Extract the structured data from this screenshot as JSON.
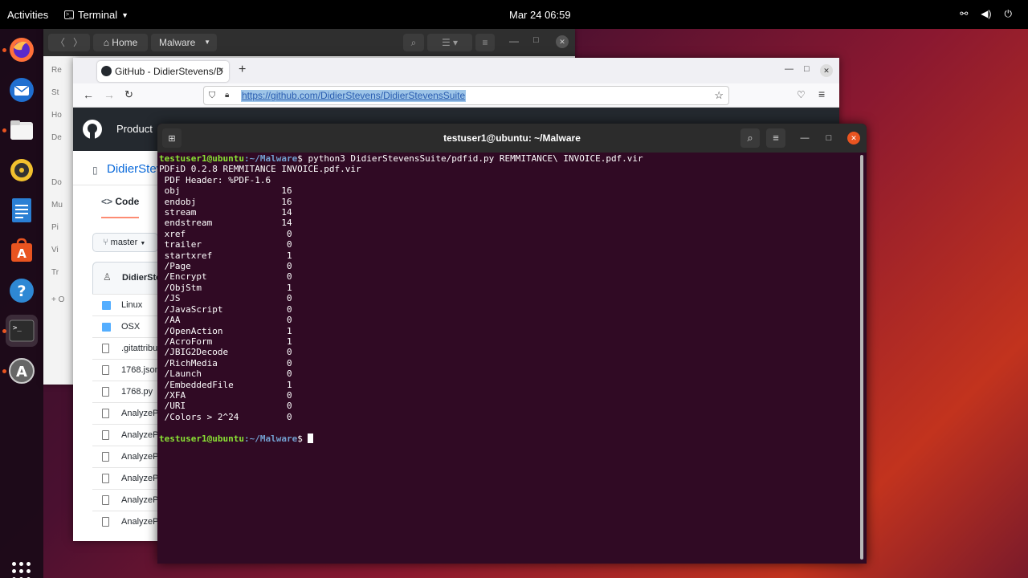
{
  "topbar": {
    "activities": "Activities",
    "app": "Terminal",
    "clock": "Mar 24  06:59"
  },
  "files_window": {
    "home": "Home",
    "location": "Malware",
    "sidebar": [
      "Re",
      "St",
      "Ho",
      "De",
      "Do",
      "Mu",
      "Pi",
      "Vi",
      "Tr",
      "+ O"
    ]
  },
  "browser": {
    "tab_title": "GitHub - DidierStevens/D",
    "url": "https://github.com/DidierStevens/DidierStevensSuite",
    "nav_product": "Product",
    "repo_owner": "DidierStev",
    "code_tab": "Code",
    "branch": "master",
    "commit_author": "DidierSte",
    "files": [
      {
        "name": "Linux",
        "type": "folder"
      },
      {
        "name": "OSX",
        "type": "folder"
      },
      {
        "name": ".gitattribut",
        "type": "file"
      },
      {
        "name": "1768.json",
        "type": "file"
      },
      {
        "name": "1768.py",
        "type": "file"
      },
      {
        "name": "AnalyzeP",
        "type": "file"
      },
      {
        "name": "AnalyzeP",
        "type": "file"
      },
      {
        "name": "AnalyzeP",
        "type": "file"
      },
      {
        "name": "AnalyzeP",
        "type": "file"
      },
      {
        "name": "AnalyzeP",
        "type": "file"
      },
      {
        "name": "AnalyzeP",
        "type": "file"
      }
    ]
  },
  "terminal": {
    "title": "testuser1@ubuntu: ~/Malware",
    "prompt_user": "testuser1@ubuntu",
    "prompt_path": ":~/Malware",
    "prompt_symbol": "$ ",
    "command": "python3 DidierStevensSuite/pdfid.py REMMITANCE\\ INVOICE.pdf.vir",
    "output": [
      "PDFiD 0.2.8 REMMITANCE INVOICE.pdf.vir",
      " PDF Header: %PDF-1.6",
      " obj                   16",
      " endobj                16",
      " stream                14",
      " endstream             14",
      " xref                   0",
      " trailer                0",
      " startxref              1",
      " /Page                  0",
      " /Encrypt               0",
      " /ObjStm                1",
      " /JS                    0",
      " /JavaScript            0",
      " /AA                    0",
      " /OpenAction            1",
      " /AcroForm              1",
      " /JBIG2Decode           0",
      " /RichMedia             0",
      " /Launch                0",
      " /EmbeddedFile          1",
      " /XFA                   0",
      " /URI                   0",
      " /Colors > 2^24         0"
    ]
  }
}
